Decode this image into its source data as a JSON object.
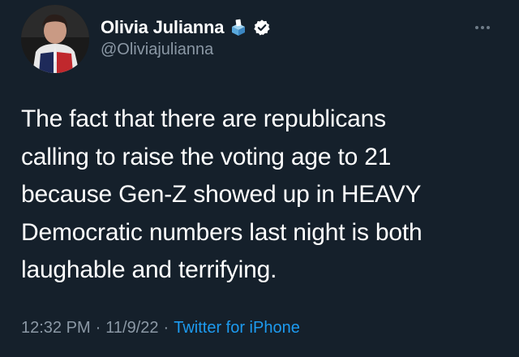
{
  "author": {
    "display_name": "Olivia Julianna",
    "handle": "@Oliviajulianna",
    "avatar_icon": "profile-photo",
    "badge_icons": [
      "ballot-box-icon",
      "verified-badge-icon"
    ]
  },
  "tweet": {
    "lines": [
      "The fact that there are republicans",
      "calling to raise the voting age to 21",
      "because Gen-Z showed up in HEAVY",
      "Democratic numbers last night is both",
      "laughable and terrifying."
    ],
    "time": "12:32 PM",
    "date": "11/9/22",
    "separator": "·",
    "source": "Twitter for iPhone"
  },
  "colors": {
    "background": "#15202b",
    "primary_text": "#ffffff",
    "secondary_text": "#8b98a5",
    "link": "#1d9bf0"
  }
}
